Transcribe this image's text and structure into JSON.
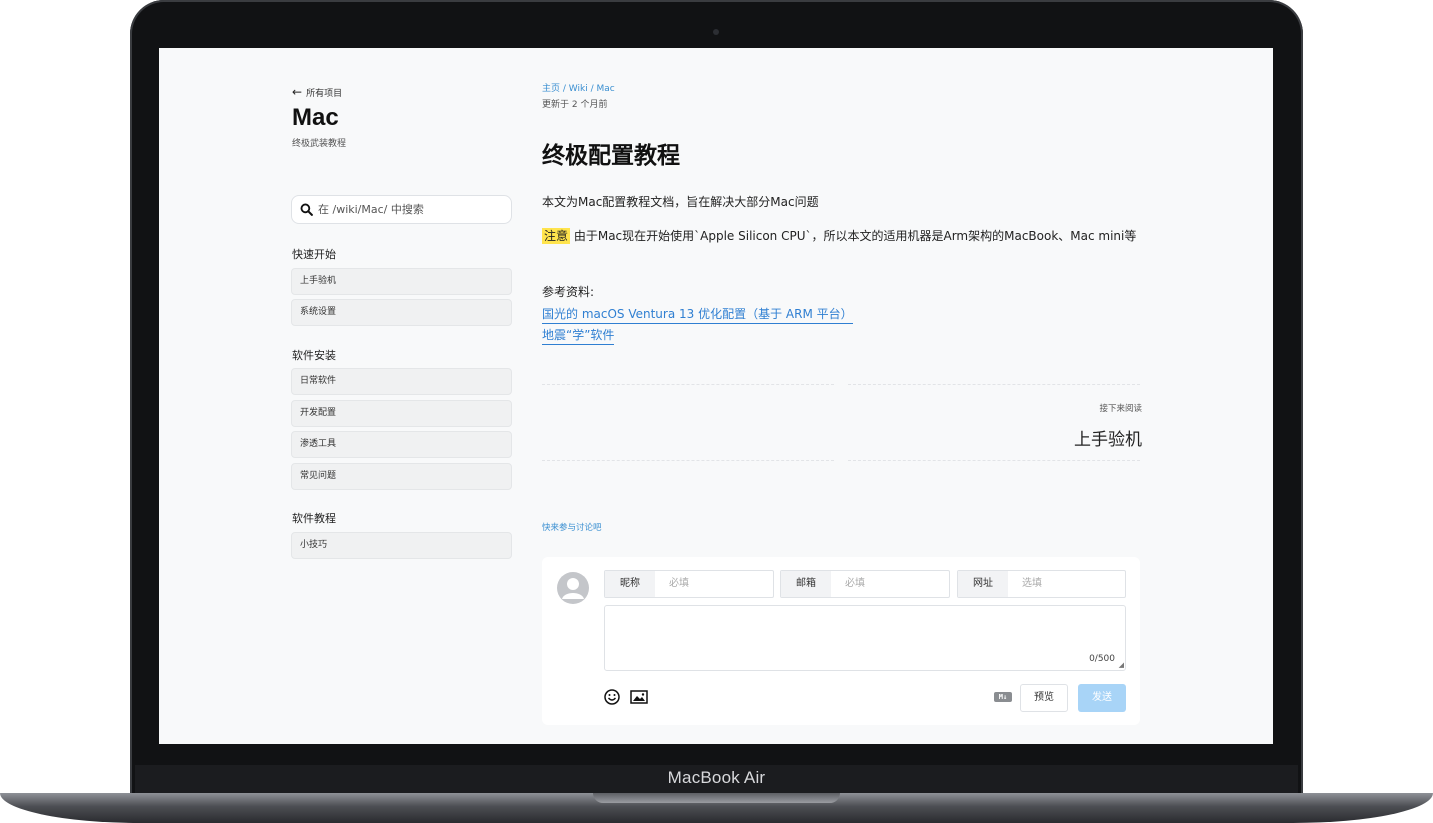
{
  "device": {
    "brand": "MacBook Air"
  },
  "sidebar": {
    "back_label": "所有项目",
    "title": "Mac",
    "subtitle": "终极武装教程",
    "search_placeholder": "在 /wiki/Mac/ 中搜索",
    "sections": [
      {
        "heading": "快速开始",
        "items": [
          "上手验机",
          "系统设置"
        ]
      },
      {
        "heading": "软件安装",
        "items": [
          "日常软件",
          "开发配置",
          "渗透工具",
          "常见问题"
        ]
      },
      {
        "heading": "软件教程",
        "items": [
          "小技巧"
        ]
      }
    ]
  },
  "main": {
    "breadcrumb": [
      "主页",
      "Wiki",
      "Mac"
    ],
    "updated": "更新于 2 个月前",
    "title": "终极配置教程",
    "intro": "本文为Mac配置教程文档，旨在解决大部分Mac问题",
    "note_tag": "注意",
    "note_text": "由于Mac现在开始使用`Apple Silicon CPU`，所以本文的适用机器是Arm架构的MacBook、Mac mini等",
    "refs_label": "参考资料:",
    "links": [
      "国光的 macOS Ventura 13 优化配置（基于 ARM 平台）",
      "地震“学”软件"
    ],
    "next_label": "接下来阅读",
    "next_title": "上手验机",
    "discuss": "快来参与讨论吧"
  },
  "comment": {
    "nickname_label": "昵称",
    "nickname_placeholder": "必填",
    "email_label": "邮箱",
    "email_placeholder": "必填",
    "url_label": "网址",
    "url_placeholder": "选填",
    "counter": "0/500",
    "markdown_badge": "M↓",
    "preview_label": "预览",
    "send_label": "发送"
  },
  "colors": {
    "accent": "#3a8fd1",
    "highlight": "#ffe44d",
    "send_disabled": "#a8d4f7"
  }
}
